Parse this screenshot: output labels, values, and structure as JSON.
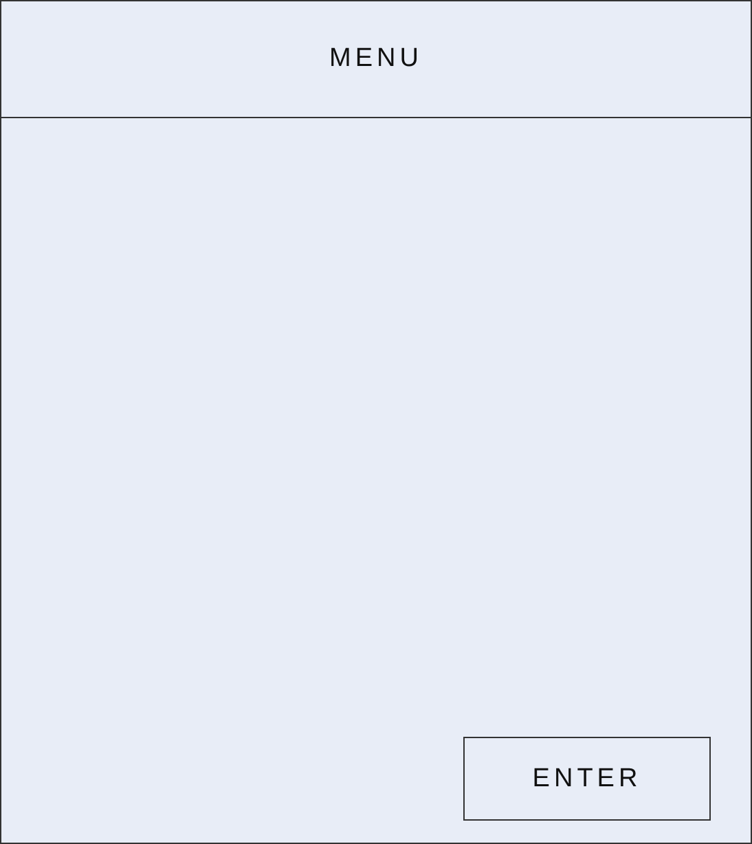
{
  "header": {
    "title": "MENU"
  },
  "buttons": [
    {
      "label": "ENTER"
    }
  ]
}
